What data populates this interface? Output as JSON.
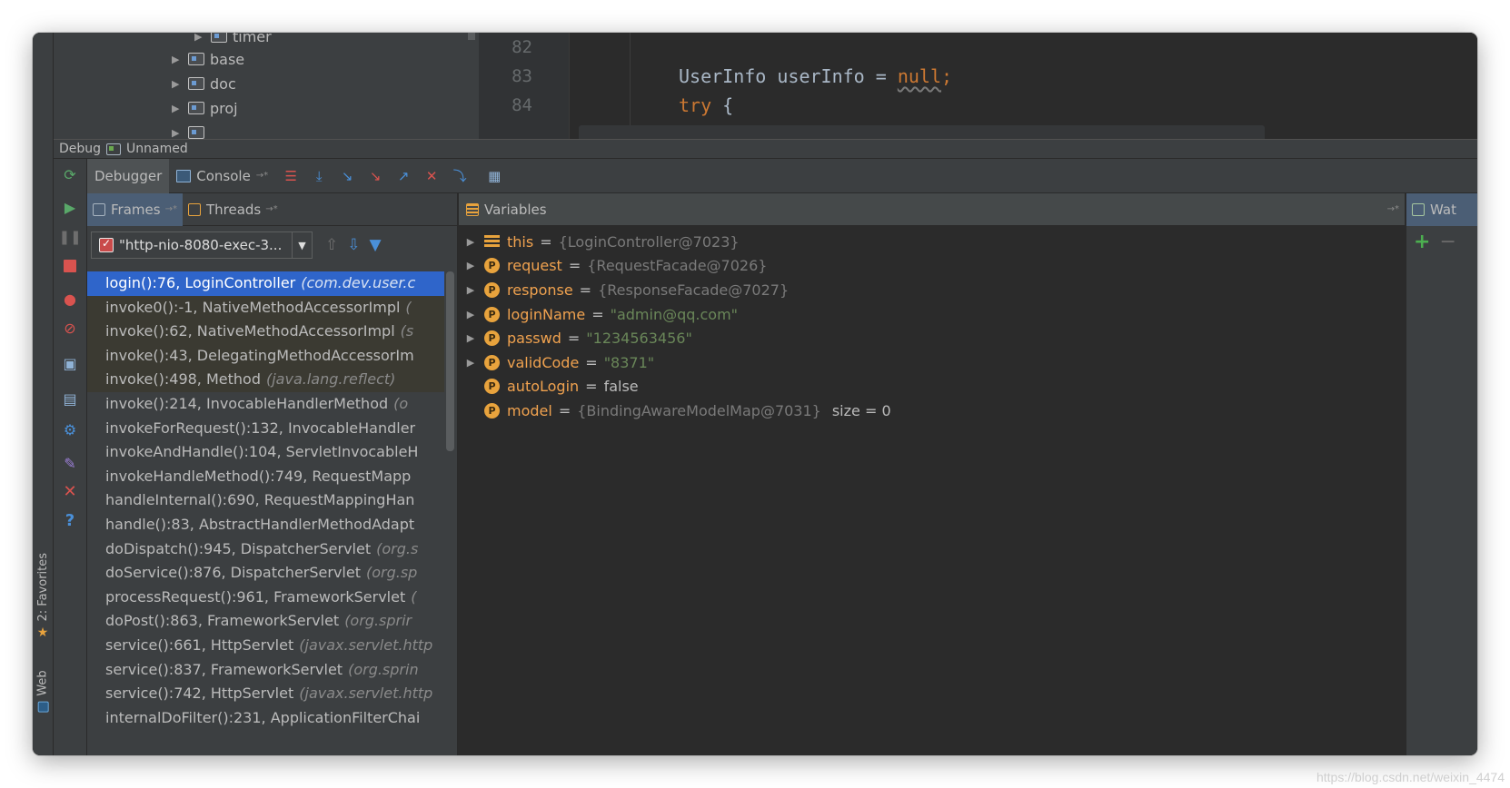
{
  "project_tree": {
    "items": [
      {
        "label": "timer"
      },
      {
        "label": "base"
      },
      {
        "label": "doc"
      },
      {
        "label": "proj"
      }
    ]
  },
  "editor": {
    "line_numbers": [
      "82",
      "83",
      "84"
    ],
    "code": {
      "line83_type": "UserInfo userInfo = ",
      "line83_null": "null",
      "line83_semicolon": ";",
      "line84_try": "try",
      "line84_brace": " {"
    }
  },
  "debug_bar": {
    "title": "Debug",
    "config_name": "Unnamed"
  },
  "debugger_tabs": [
    {
      "label": "Debugger"
    },
    {
      "label": "Console"
    }
  ],
  "frames_pane": {
    "tabs": [
      {
        "label": "Frames"
      },
      {
        "label": "Threads"
      }
    ],
    "thread_selector": "\"http-nio-8080-exec-3...",
    "frames": [
      {
        "method": "login():76, LoginController",
        "pkg": "(com.dev.user.c"
      },
      {
        "method": "invoke0():-1, NativeMethodAccessorImpl",
        "pkg": "("
      },
      {
        "method": "invoke():62, NativeMethodAccessorImpl",
        "pkg": "(s"
      },
      {
        "method": "invoke():43, DelegatingMethodAccessorIm",
        "pkg": ""
      },
      {
        "method": "invoke():498, Method",
        "pkg": "(java.lang.reflect)"
      },
      {
        "method": "invoke():214, InvocableHandlerMethod",
        "pkg": "(o"
      },
      {
        "method": "invokeForRequest():132, InvocableHandler",
        "pkg": ""
      },
      {
        "method": "invokeAndHandle():104, ServletInvocableH",
        "pkg": ""
      },
      {
        "method": "invokeHandleMethod():749, RequestMapp",
        "pkg": ""
      },
      {
        "method": "handleInternal():690, RequestMappingHan",
        "pkg": ""
      },
      {
        "method": "handle():83, AbstractHandlerMethodAdapt",
        "pkg": ""
      },
      {
        "method": "doDispatch():945, DispatcherServlet",
        "pkg": "(org.s"
      },
      {
        "method": "doService():876, DispatcherServlet",
        "pkg": "(org.sp"
      },
      {
        "method": "processRequest():961, FrameworkServlet",
        "pkg": "("
      },
      {
        "method": "doPost():863, FrameworkServlet",
        "pkg": "(org.sprir"
      },
      {
        "method": "service():661, HttpServlet",
        "pkg": "(javax.servlet.http"
      },
      {
        "method": "service():837, FrameworkServlet",
        "pkg": "(org.sprin"
      },
      {
        "method": "service():742, HttpServlet",
        "pkg": "(javax.servlet.http"
      },
      {
        "method": "internalDoFilter():231, ApplicationFilterChai",
        "pkg": ""
      }
    ]
  },
  "variables_pane": {
    "title": "Variables",
    "vars": [
      {
        "name": "this",
        "value": "{LoginController@7023}",
        "kind": "obj",
        "extra": ""
      },
      {
        "name": "request",
        "value": "{RequestFacade@7026}",
        "kind": "obj",
        "extra": ""
      },
      {
        "name": "response",
        "value": "{ResponseFacade@7027}",
        "kind": "obj",
        "extra": ""
      },
      {
        "name": "loginName",
        "value": "\"admin@qq.com\"",
        "kind": "str",
        "extra": ""
      },
      {
        "name": "passwd",
        "value": "\"1234563456\"",
        "kind": "str",
        "extra": ""
      },
      {
        "name": "validCode",
        "value": "\"8371\"",
        "kind": "str",
        "extra": ""
      },
      {
        "name": "autoLogin",
        "value": "false",
        "kind": "plain",
        "extra": ""
      },
      {
        "name": "model",
        "value": "{BindingAwareModelMap@7031}",
        "kind": "obj",
        "extra": "size = 0"
      }
    ]
  },
  "watches_pane": {
    "title": "Wat"
  },
  "left_strip": {
    "favorites": "2: Favorites",
    "web": "Web"
  },
  "watermark": "https://blog.csdn.net/weixin_4474"
}
